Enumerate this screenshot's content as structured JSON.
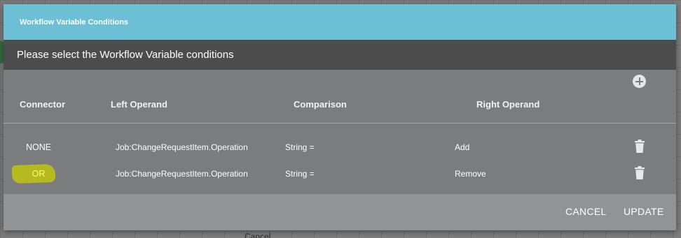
{
  "background": {
    "cancel_text": "Cancel"
  },
  "dialog": {
    "title": "Workflow Variable Conditions",
    "subtitle": "Please select the Workflow Variable conditions",
    "add_icon": "plus-circle-icon",
    "delete_icon": "trash-icon",
    "columns": {
      "connector": "Connector",
      "left_operand": "Left Operand",
      "comparison": "Comparison",
      "right_operand": "Right Operand"
    },
    "rows": [
      {
        "connector": "NONE",
        "left_operand": "Job:ChangeRequestItem.Operation",
        "comparison": "String =",
        "right_operand": "Add",
        "highlighted": false
      },
      {
        "connector": "OR",
        "left_operand": "Job:ChangeRequestItem.Operation",
        "comparison": "String =",
        "right_operand": "Remove",
        "highlighted": true
      }
    ],
    "buttons": {
      "cancel": "CANCEL",
      "update": "UPDATE"
    }
  },
  "colors": {
    "title_bar": "#6dbfd6",
    "subheader": "#4c4c4c",
    "content": "#7b7c7e",
    "footer": "#929394",
    "highlight": "#b7ba1e",
    "highlight_text": "#ffff66"
  }
}
